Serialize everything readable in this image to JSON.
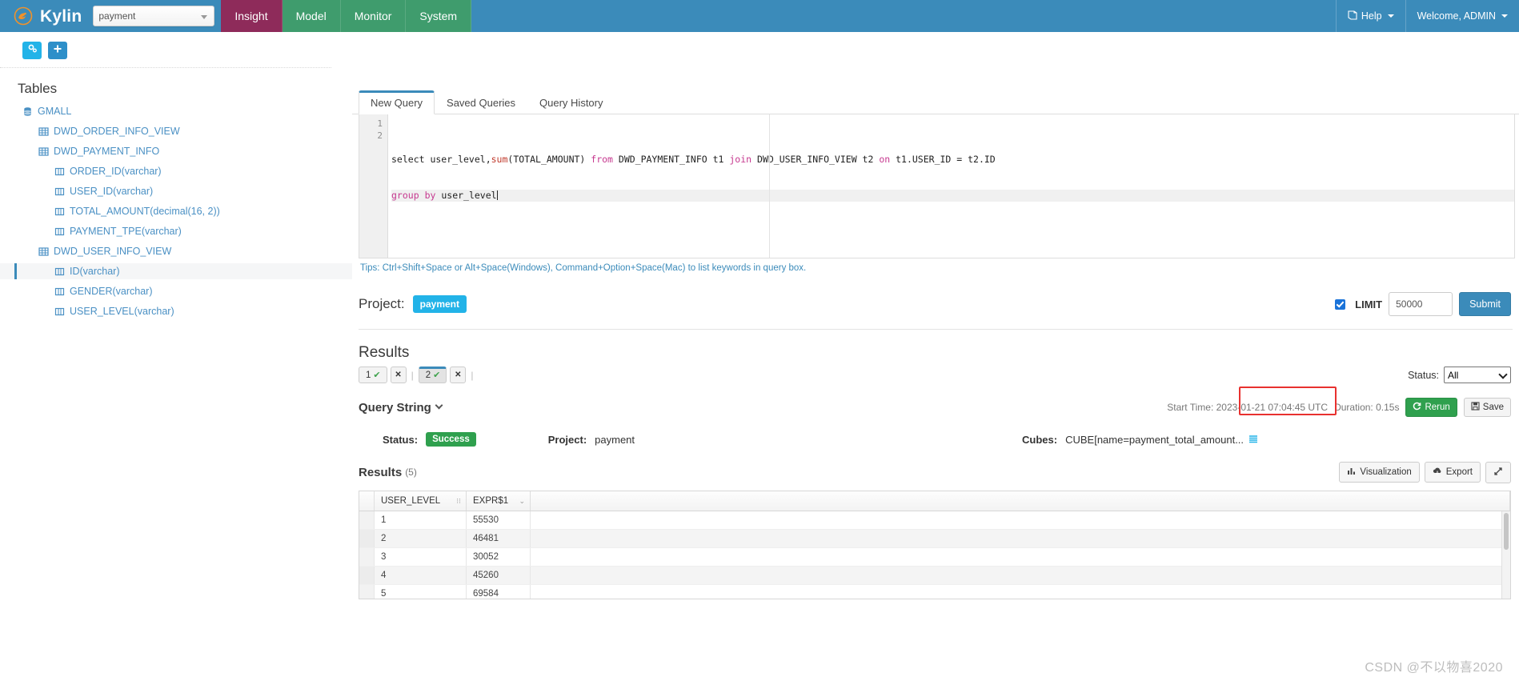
{
  "navbar": {
    "brand": "Kylin",
    "brand_logo_icon": "kylin-logo-icon",
    "project_select_value": "payment",
    "items": [
      {
        "label": "Insight",
        "active": true
      },
      {
        "label": "Model",
        "active": false
      },
      {
        "label": "Monitor",
        "active": false
      },
      {
        "label": "System",
        "active": false
      }
    ],
    "help_label": "Help",
    "help_icon": "book-icon",
    "user_label": "Welcome, ADMIN"
  },
  "sidebar": {
    "toolbar": [
      {
        "name": "settings-gears-button",
        "icon": "gears-icon"
      },
      {
        "name": "add-table-button",
        "icon": "plus-icon"
      }
    ],
    "title": "Tables",
    "tree": [
      {
        "label": "GMALL",
        "level": 0,
        "icon": "database-icon",
        "selected": false
      },
      {
        "label": "DWD_ORDER_INFO_VIEW",
        "level": 1,
        "icon": "table-icon",
        "selected": false
      },
      {
        "label": "DWD_PAYMENT_INFO",
        "level": 1,
        "icon": "table-icon",
        "selected": false
      },
      {
        "label": "ORDER_ID(varchar)",
        "level": 2,
        "icon": "column-icon",
        "selected": false
      },
      {
        "label": "USER_ID(varchar)",
        "level": 2,
        "icon": "column-icon",
        "selected": false
      },
      {
        "label": "TOTAL_AMOUNT(decimal(16, 2))",
        "level": 2,
        "icon": "column-icon",
        "selected": false
      },
      {
        "label": "PAYMENT_TPE(varchar)",
        "level": 2,
        "icon": "column-icon",
        "selected": false
      },
      {
        "label": "DWD_USER_INFO_VIEW",
        "level": 1,
        "icon": "table-icon",
        "selected": false
      },
      {
        "label": "ID(varchar)",
        "level": 2,
        "icon": "column-icon",
        "selected": true
      },
      {
        "label": "GENDER(varchar)",
        "level": 2,
        "icon": "column-icon",
        "selected": false
      },
      {
        "label": "USER_LEVEL(varchar)",
        "level": 2,
        "icon": "column-icon",
        "selected": false
      }
    ]
  },
  "query_tabs": [
    {
      "label": "New Query",
      "active": true
    },
    {
      "label": "Saved Queries",
      "active": false
    },
    {
      "label": "Query History",
      "active": false
    }
  ],
  "editor": {
    "line_numbers": [
      "1",
      "2"
    ],
    "line1_plain_a": "select user_level,",
    "line1_fn": "sum",
    "line1_plain_b": "(TOTAL_AMOUNT) ",
    "line1_kw_from": "from",
    "line1_plain_c": " DWD_PAYMENT_INFO t1 ",
    "line1_kw_join": "join",
    "line1_plain_d": " DWD_USER_INFO_VIEW t2 ",
    "line1_kw_on": "on",
    "line1_plain_e": " t1.USER_ID = t2.ID",
    "line2_kw_group": "group",
    "line2_plain_a": " ",
    "line2_kw_by": "by",
    "line2_plain_b": " user_level",
    "full_sql": "select user_level,sum(TOTAL_AMOUNT) from DWD_PAYMENT_INFO t1 join DWD_USER_INFO_VIEW t2 on t1.USER_ID = t2.ID\ngroup by user_level",
    "tips": "Tips: Ctrl+Shift+Space or Alt+Space(Windows), Command+Option+Space(Mac) to list keywords in query box."
  },
  "project_row": {
    "label": "Project:",
    "value": "payment",
    "limit_label": "LIMIT",
    "limit_checked": true,
    "limit_value": "50000",
    "submit_label": "Submit"
  },
  "results_section": {
    "heading": "Results",
    "tabs": [
      {
        "label": "1",
        "status_icon": "check-icon",
        "active": false,
        "close_icon": "close-icon"
      },
      {
        "label": "2",
        "status_icon": "check-icon",
        "active": true,
        "close_icon": "close-icon"
      }
    ],
    "status_filter_label": "Status:",
    "status_filter_value": "All"
  },
  "query_string": {
    "title": "Query String",
    "collapse_icon": "chevron-down-icon",
    "start_time": "Start Time: 2023-01-21 07:04:45 UTC",
    "duration": "Duration: 0.15s",
    "rerun_label": "Rerun",
    "rerun_icon": "refresh-icon",
    "save_label": "Save",
    "save_icon": "floppy-icon"
  },
  "info_row": {
    "status_label": "Status:",
    "status_value": "Success",
    "project_label": "Project:",
    "project_value": "payment",
    "cubes_label": "Cubes:",
    "cubes_value": "CUBE[name=payment_total_amount...",
    "cubes_icon": "list-icon"
  },
  "results_table": {
    "title": "Results",
    "count": "(5)",
    "visualization_label": "Visualization",
    "visualization_icon": "bar-chart-icon",
    "export_label": "Export",
    "export_icon": "cloud-download-icon",
    "expand_icon": "expand-arrows-icon",
    "columns": [
      "USER_LEVEL",
      "EXPR$1"
    ],
    "col_sort_icons": [
      "sort-icon",
      "chevron-down-icon"
    ],
    "rows": [
      [
        "1",
        "55530"
      ],
      [
        "2",
        "46481"
      ],
      [
        "3",
        "30052"
      ],
      [
        "4",
        "45260"
      ],
      [
        "5",
        "69584"
      ]
    ]
  },
  "watermark": "CSDN @不以物喜2020",
  "colors": {
    "nav_blue": "#3b8bba",
    "nav_green": "#3f9c6d",
    "nav_active": "#8e2b5a",
    "accent_cyan": "#22b3e8",
    "success_green": "#2fa04e",
    "highlight_red": "#e8312f",
    "link_blue": "#4a90c4"
  }
}
